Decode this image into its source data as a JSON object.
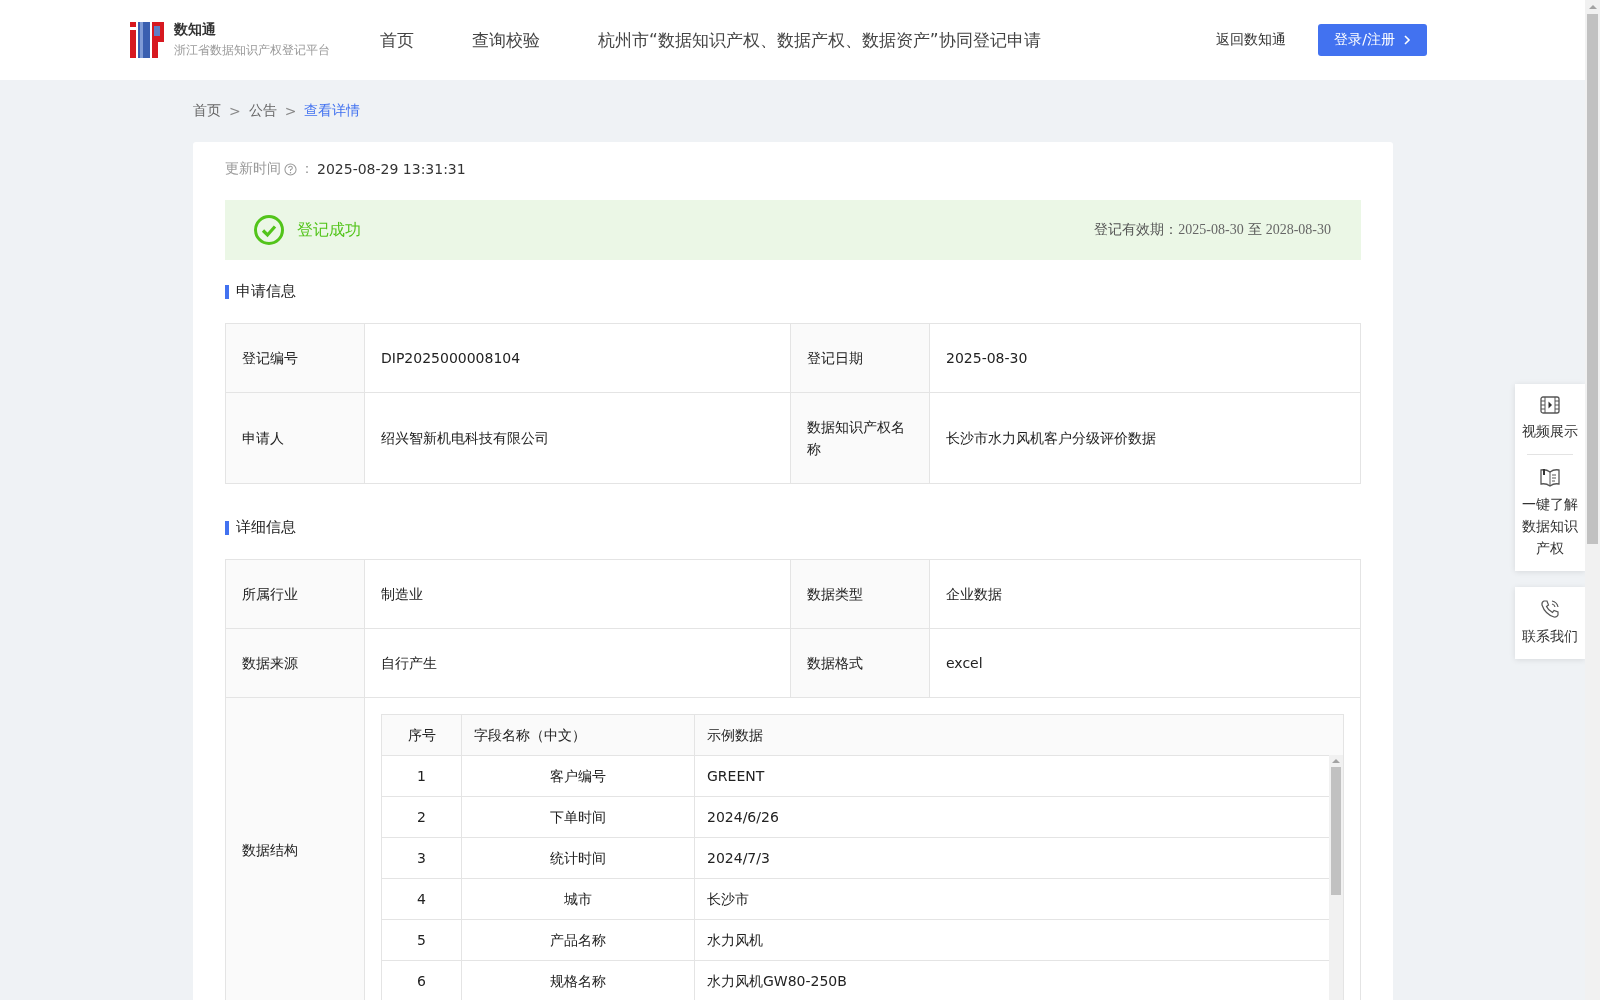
{
  "header": {
    "logo_title": "数知通",
    "logo_subtitle": "浙江省数据知识产权登记平台",
    "nav": [
      "首页",
      "查询校验",
      "杭州市“数据知识产权、数据产权、数据资产”协同登记申请"
    ],
    "back_link": "返回数知通",
    "login_button": "登录/注册"
  },
  "breadcrumb": {
    "separator": ">",
    "items": [
      {
        "label": "首页",
        "current": false
      },
      {
        "label": "公告",
        "current": false
      },
      {
        "label": "查看详情",
        "current": true
      }
    ]
  },
  "update": {
    "label": "更新时间",
    "separator": "：",
    "value": "2025-08-29 13:31:31"
  },
  "status": {
    "kind": "success",
    "text": "登记成功",
    "validity_label": "登记有效期：",
    "start": "2025-08-30",
    "to": "至",
    "end": "2028-08-30"
  },
  "sections": [
    {
      "title": "申请信息",
      "rows": [
        [
          {
            "label": "登记编号",
            "value": "DIP2025000008104"
          },
          {
            "label": "登记日期",
            "value": "2025-08-30"
          }
        ],
        [
          {
            "label": "申请人",
            "value": "绍兴智新机电科技有限公司"
          },
          {
            "label": "数据知识产权名称",
            "value": "长沙市水力风机客户分级评价数据"
          }
        ]
      ]
    },
    {
      "title": "详细信息",
      "rows": [
        [
          {
            "label": "所属行业",
            "value": "制造业"
          },
          {
            "label": "数据类型",
            "value": "企业数据"
          }
        ],
        [
          {
            "label": "数据来源",
            "value": "自行产生"
          },
          {
            "label": "数据格式",
            "value": "excel"
          }
        ]
      ],
      "structure": {
        "label": "数据结构",
        "columns": [
          "序号",
          "字段名称（中文）",
          "示例数据"
        ],
        "rows": [
          [
            "1",
            "客户编号",
            "GREENT"
          ],
          [
            "2",
            "下单时间",
            "2024/6/26"
          ],
          [
            "3",
            "统计时间",
            "2024/7/3"
          ],
          [
            "4",
            "城市",
            "长沙市"
          ],
          [
            "5",
            "产品名称",
            "水力风机"
          ],
          [
            "6",
            "规格名称",
            "水力风机GW80-250B"
          ]
        ]
      }
    }
  ],
  "side_panels": [
    {
      "items": [
        "视频展示",
        "一键了解数据知识产权"
      ]
    },
    {
      "items": [
        "联系我们"
      ]
    }
  ]
}
